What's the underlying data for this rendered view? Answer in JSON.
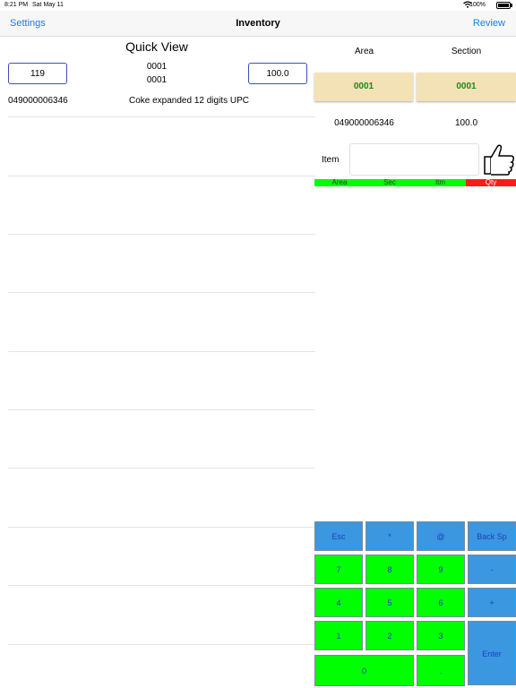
{
  "status_bar": {
    "time": "8:21 PM",
    "date": "Sat May 11",
    "battery": "100%"
  },
  "nav": {
    "left": "Settings",
    "title": "Inventory",
    "right": "Review"
  },
  "quick_view": {
    "title": "Quick View",
    "count_box": "119",
    "area_code": "0001",
    "section_code": "0001",
    "qty_box": "100.0",
    "upc": "049000006346",
    "description": "Coke expanded 12 digits UPC"
  },
  "right_panel": {
    "area_header": "Area",
    "section_header": "Section",
    "area_value": "0001",
    "section_value": "0001",
    "upc": "049000006346",
    "qty": "100.0",
    "item_label": "Item",
    "item_value": "",
    "indicators": [
      {
        "label": "Area",
        "color": "#00ff00"
      },
      {
        "label": "Sec",
        "color": "#00ff00"
      },
      {
        "label": "Itm",
        "color": "#00ff00"
      },
      {
        "label": "Qty",
        "color": "#ff1a1a"
      }
    ]
  },
  "keypad": {
    "esc": "Esc",
    "star": "*",
    "at": "@",
    "backsp": "Back Sp",
    "k7": "7",
    "k8": "8",
    "k9": "9",
    "minus": "-",
    "k4": "4",
    "k5": "5",
    "k6": "6",
    "plus": "+",
    "k1": "1",
    "k2": "2",
    "k3": "3",
    "enter": "Enter",
    "k0": "0",
    "dot": "."
  },
  "colors": {
    "accent": "#1a7ee6",
    "key_blue": "#3b97e0",
    "key_green": "#00ff00",
    "tan": "#f2e2b6"
  }
}
